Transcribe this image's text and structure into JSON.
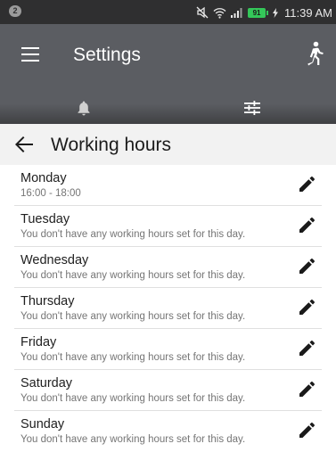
{
  "status_bar": {
    "notification_count": "2",
    "battery_level": "91",
    "time": "11:39 AM",
    "icons": [
      "mute-icon",
      "wifi-icon",
      "signal-icon",
      "battery-icon",
      "charging-icon"
    ]
  },
  "app_bar": {
    "title": "Settings",
    "menu_icon": "menu-icon",
    "action_icon": "running-person-icon",
    "background": "#5b5d62"
  },
  "tabs": [
    {
      "icon": "bell-icon",
      "selected": false
    },
    {
      "icon": "sliders-icon",
      "selected": true
    }
  ],
  "section": {
    "title": "Working hours",
    "back_icon": "back-arrow-icon"
  },
  "days": [
    {
      "name": "Monday",
      "hours": "16:00 - 18:00"
    },
    {
      "name": "Tuesday",
      "hours": "You don't have any working hours set for this day."
    },
    {
      "name": "Wednesday",
      "hours": "You don't have any working hours set for this day."
    },
    {
      "name": "Thursday",
      "hours": "You don't have any working hours set for this day."
    },
    {
      "name": "Friday",
      "hours": "You don't have any working hours set for this day."
    },
    {
      "name": "Saturday",
      "hours": "You don't have any working hours set for this day."
    },
    {
      "name": "Sunday",
      "hours": "You don't have any working hours set for this day."
    }
  ]
}
